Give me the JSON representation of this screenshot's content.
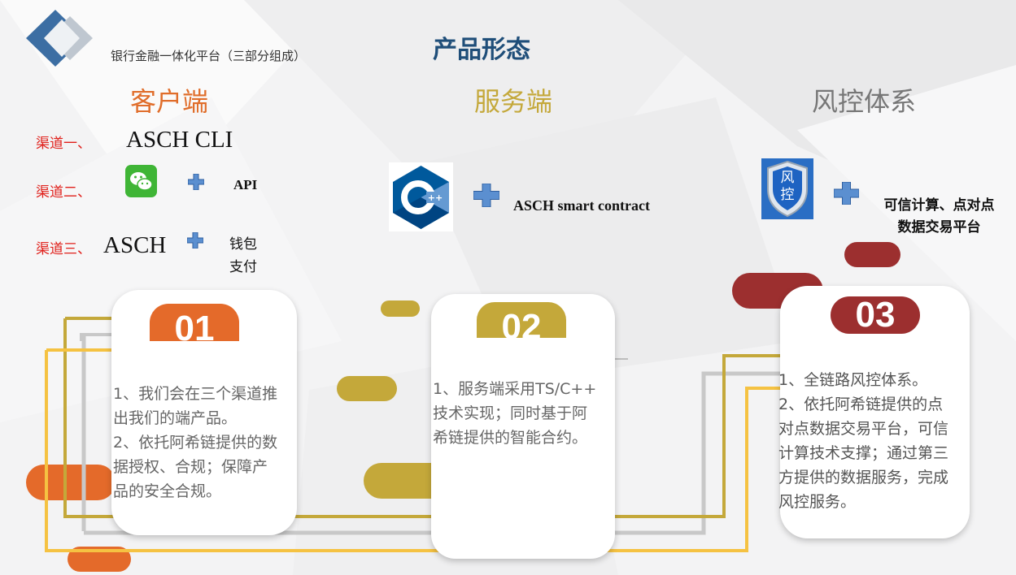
{
  "header": {
    "subtitle": "银行金融一体化平台（三部分组成）",
    "title": "产品形态"
  },
  "columns": {
    "client": {
      "heading": "客户端",
      "channels": [
        {
          "label": "渠道一、",
          "value": "ASCH CLI"
        },
        {
          "label": "渠道二、",
          "icon": "wechat-icon",
          "value": "API"
        },
        {
          "label": "渠道三、",
          "value": "ASCH",
          "extra": [
            "钱包",
            "支付"
          ]
        }
      ]
    },
    "server": {
      "heading": "服务端",
      "icon": "cpp-icon",
      "value": "ASCH smart contract"
    },
    "risk": {
      "heading": "风控体系",
      "icon": "shield-icon",
      "icon_text": [
        "风",
        "控"
      ],
      "lines": [
        "可信计算、点对点",
        "数据交易平台"
      ]
    }
  },
  "cards": [
    {
      "number": "01",
      "color": "#e46a2a",
      "lines": [
        "1、我们会在三个渠道推",
        "出我们的端产品。",
        "2、依托阿希链提供的数",
        "据授权、合规；保障产",
        "品的安全合规。"
      ]
    },
    {
      "number": "02",
      "color": "#c4a83a",
      "lines": [
        "1、服务端采用TS/C++",
        "技术实现；同时基于阿",
        "希链提供的智能合约。"
      ]
    },
    {
      "number": "03",
      "color": "#9c2f2f",
      "lines": [
        "1、全链路风控体系。",
        "2、依托阿希链提供的点",
        "对点数据交易平台，可信",
        "计算技术支撑；通过第三",
        "方提供的数据服务，完成",
        "风控服务。"
      ]
    }
  ],
  "colors": {
    "orange": "#e46a2a",
    "gold": "#c4a83a",
    "crimson": "#9c2f2f",
    "yellow_line": "#f5c242",
    "title_blue": "#1f4e79",
    "channel_red": "#e0201b"
  }
}
